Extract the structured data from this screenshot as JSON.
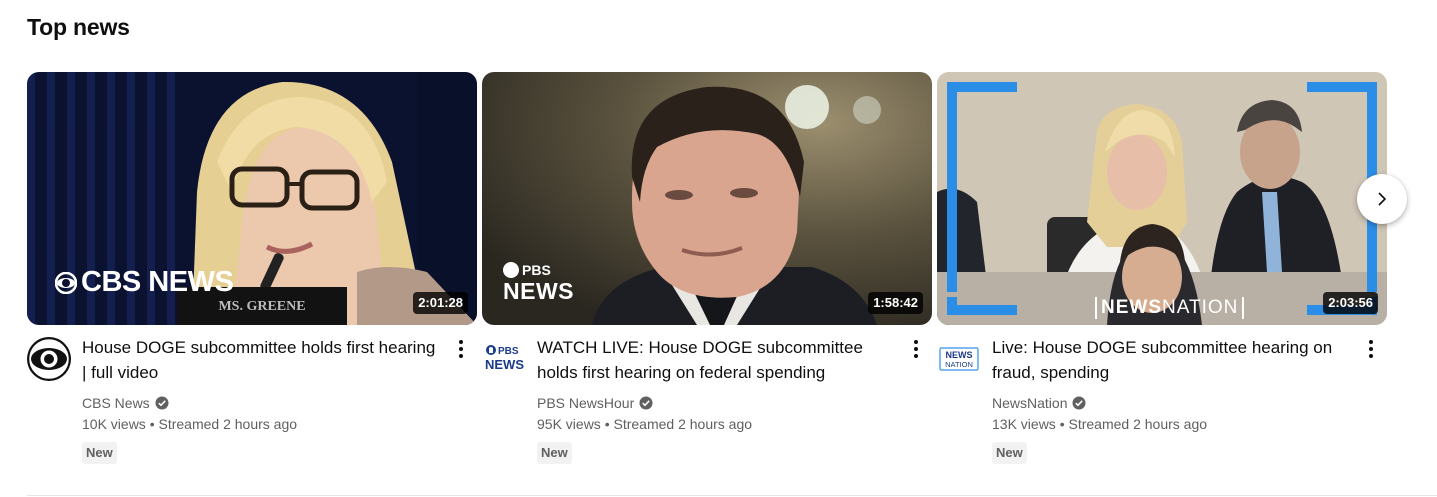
{
  "shelf": {
    "title": "Top news"
  },
  "videos": [
    {
      "title": "House DOGE subcommittee holds first hearing | full video",
      "channel": "CBS News",
      "views": "10K views",
      "age": "Streamed 2 hours ago",
      "badge": "New",
      "duration": "2:01:28",
      "watermark": "CBS NEWS",
      "nameplate": "MS. GREENE"
    },
    {
      "title": "WATCH LIVE: House DOGE subcommittee holds first hearing on federal spending",
      "channel": "PBS NewsHour",
      "views": "95K views",
      "age": "Streamed 2 hours ago",
      "badge": "New",
      "duration": "1:58:42",
      "watermark_top": "PBS",
      "watermark_bottom": "NEWS"
    },
    {
      "title": "Live: House DOGE subcommittee hearing on fraud, spending",
      "channel": "NewsNation",
      "views": "13K views",
      "age": "Streamed 2 hours ago",
      "badge": "New",
      "duration": "2:03:56",
      "watermark_bold": "NEWS",
      "watermark_light": "NATION",
      "avatar_line1": "NEWS",
      "avatar_line2": "NATION"
    }
  ],
  "icons": {
    "verified": "check-circle-icon",
    "menu": "three-dots-vertical-icon",
    "next": "chevron-right-icon"
  },
  "colors": {
    "text_primary": "#0f0f0f",
    "text_secondary": "#606060",
    "badge_bg": "#f2f2f2",
    "newsnation_blue": "#2a8de6"
  }
}
